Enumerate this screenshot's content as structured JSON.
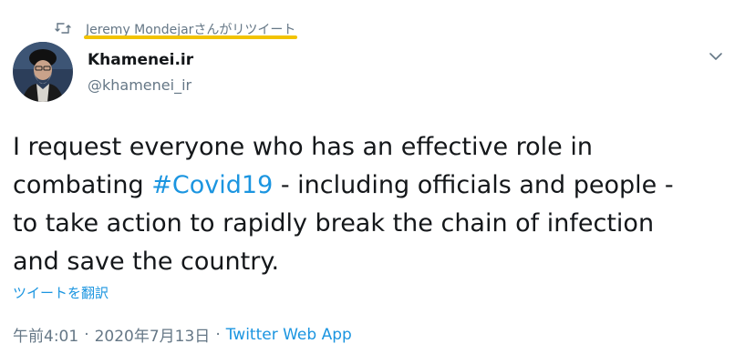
{
  "retweet": {
    "icon": "retweet-icon",
    "text": "Jeremy Mondejarさんがリツイート"
  },
  "author": {
    "avatar": "avatar-image",
    "display_name": "Khamenei.ir",
    "handle": "@khamenei_ir"
  },
  "menu": {
    "icon": "chevron-down-icon"
  },
  "tweet": {
    "line1": "I request everyone who has an effective role in",
    "line2_pre": "combating ",
    "hashtag": "#Covid19",
    "line2_post": " - including officials and people -",
    "line3": "to take action to rapidly break the chain of infection",
    "line4": "and save the country."
  },
  "translate_label": "ツイートを翻訳",
  "meta": {
    "time": "午前4:01",
    "separator": "·",
    "date": "2020年7月13日",
    "source": "Twitter Web App"
  },
  "colors": {
    "link": "#1b95e0",
    "secondary": "#657786",
    "highlight": "#f2c300"
  }
}
